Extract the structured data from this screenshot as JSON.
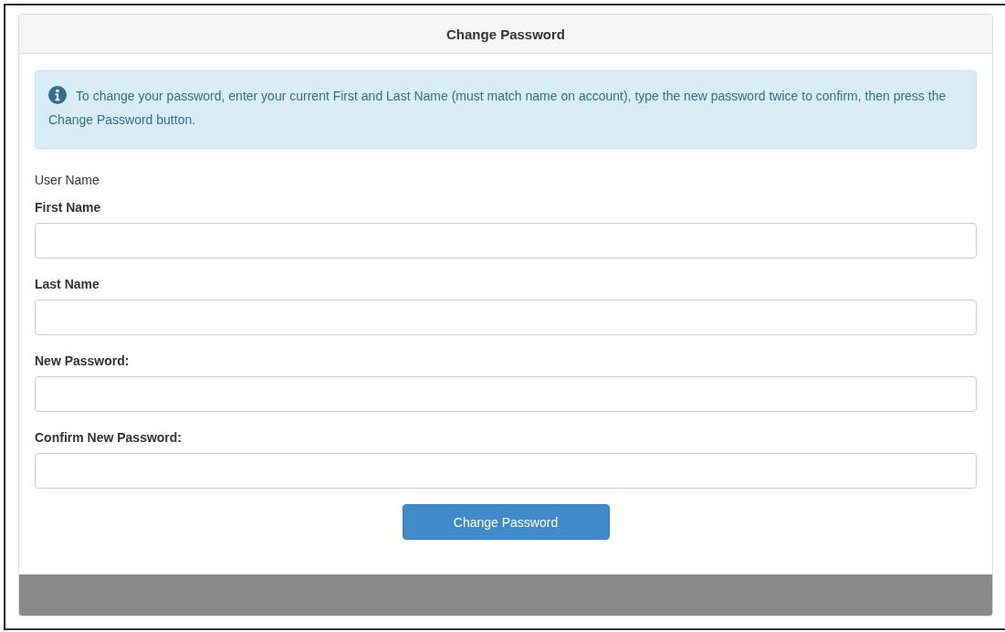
{
  "panel": {
    "title": "Change Password"
  },
  "alert": {
    "text": "To change your password, enter your current First and Last Name (must match name on account), type the new password twice to confirm, then press the Change Password button."
  },
  "user_name_label": "User Name",
  "fields": [
    {
      "label": "First Name"
    },
    {
      "label": "Last Name"
    },
    {
      "label": "New Password:"
    },
    {
      "label": "Confirm New Password:"
    }
  ],
  "submit_button": "Change Password"
}
